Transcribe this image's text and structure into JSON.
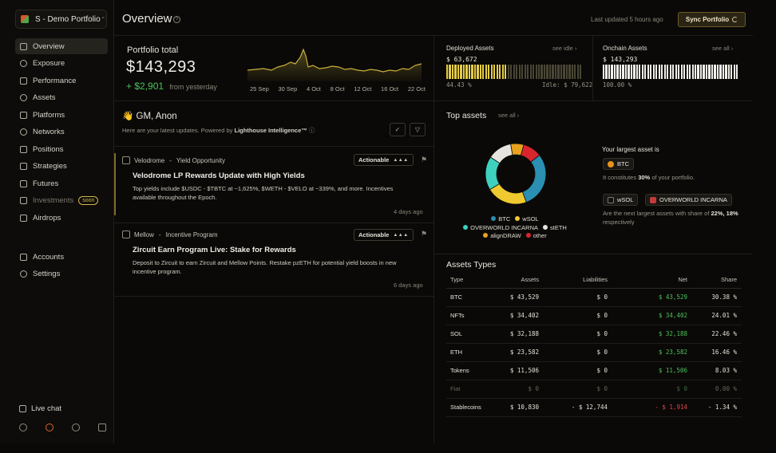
{
  "sidebar": {
    "portfolio_name": "S - Demo Portfolio",
    "items": [
      {
        "label": "Overview"
      },
      {
        "label": "Exposure"
      },
      {
        "label": "Performance"
      },
      {
        "label": "Assets"
      },
      {
        "label": "Platforms"
      },
      {
        "label": "Networks"
      },
      {
        "label": "Positions"
      },
      {
        "label": "Strategies"
      },
      {
        "label": "Futures"
      },
      {
        "label": "Investments",
        "badge": "soon"
      },
      {
        "label": "Airdrops"
      }
    ],
    "secondary": [
      {
        "label": "Accounts"
      },
      {
        "label": "Settings"
      }
    ],
    "live_chat": "Live chat"
  },
  "header": {
    "title": "Overview",
    "last_updated": "Last updated 5 hours ago",
    "sync_label": "Sync Portfolio"
  },
  "portfolio": {
    "label": "Portfolio total",
    "value": "$143,293",
    "change_sign": "+",
    "change_value": "$2,901",
    "change_suffix": "from yesterday",
    "dates": [
      "25 Sep",
      "30 Sep",
      "4 Oct",
      "8 Oct",
      "12 Oct",
      "16 Oct",
      "22 Oct"
    ]
  },
  "deployed": {
    "label": "Deployed Assets",
    "link": "see idle",
    "value": "$ 63,672",
    "percent": "44.43 %",
    "idle": "Idle: $ 79,622",
    "fill_fraction": 0.4443
  },
  "onchain": {
    "label": "Onchain Assets",
    "link": "see all",
    "value": "$ 143,293",
    "percent": "100.00 %",
    "fill_fraction": 1.0
  },
  "feed": {
    "title": "👋 GM, Anon",
    "subtitle_prefix": "Here are your latest updates. Powered by",
    "subtitle_brand": "Lighthouse Intelligence™",
    "cards": [
      {
        "source": "Velodrome",
        "category": "Yield Opportunity",
        "status": "Actionable",
        "title": "Velodrome LP Rewards Update with High Yields",
        "body": "Top yields include $USDC - $TBTC at ~1,625%, $WETH - $VELO at ~339%, and more. Incentives available throughout the Epoch.",
        "time": "4 days ago"
      },
      {
        "source": "Mellow",
        "category": "Incentive Program",
        "status": "Actionable",
        "title": "Zircuit Earn Program Live: Stake for Rewards",
        "body": "Deposit to Zircuit to earn Zircuit and Mellow Points. Restake pzETH for potential yield boosts in new incentive program.",
        "time": "6 days ago"
      }
    ]
  },
  "top_assets": {
    "title": "Top assets",
    "link": "see all",
    "largest_title": "Your largest asset is",
    "largest_asset": "BTC",
    "constitutes_prefix": "It constitutes",
    "constitutes_value": "30%",
    "constitutes_suffix": "of your portfolio.",
    "next_assets": [
      "wSOL",
      "OVERWORLD INCARNA"
    ],
    "next_note_prefix": "Are the next largest assets with share of",
    "next_note_values": "22%, 18%",
    "next_note_suffix": "respectively",
    "legend": [
      {
        "name": "BTC",
        "color": "#2a8fb0"
      },
      {
        "name": "wSOL",
        "color": "#f0c930"
      },
      {
        "name": "OVERWORLD INCARNA",
        "color": "#3ed1c0"
      },
      {
        "name": "stETH",
        "color": "#e6e4de"
      },
      {
        "name": "alignDRAW",
        "color": "#e8a21c"
      },
      {
        "name": "other",
        "color": "#d9262e"
      }
    ]
  },
  "chart_data": {
    "type": "pie",
    "categories": [
      "BTC",
      "wSOL",
      "OVERWORLD INCARNA",
      "stETH",
      "alignDRAW",
      "other"
    ],
    "values": [
      30,
      22,
      18,
      13,
      7,
      10
    ]
  },
  "asset_types": {
    "title": "Assets Types",
    "headers": [
      "Type",
      "Assets",
      "Liabilities",
      "Net",
      "Share"
    ],
    "rows": [
      {
        "type": "BTC",
        "assets": "$ 43,529",
        "liabilities": "$ 0",
        "net": "$ 43,529",
        "share": "30.38 %",
        "net_class": "pos"
      },
      {
        "type": "NFTs",
        "assets": "$ 34,402",
        "liabilities": "$ 0",
        "net": "$ 34,402",
        "share": "24.01 %",
        "net_class": "pos"
      },
      {
        "type": "SOL",
        "assets": "$ 32,188",
        "liabilities": "$ 0",
        "net": "$ 32,188",
        "share": "22.46 %",
        "net_class": "pos"
      },
      {
        "type": "ETH",
        "assets": "$ 23,582",
        "liabilities": "$ 0",
        "net": "$ 23,582",
        "share": "16.46 %",
        "net_class": "pos"
      },
      {
        "type": "Tokens",
        "assets": "$ 11,506",
        "liabilities": "$ 0",
        "net": "$ 11,506",
        "share": "8.03 %",
        "net_class": "pos"
      },
      {
        "type": "Fiat",
        "assets": "$ 0",
        "liabilities": "$ 0",
        "net": "$ 0",
        "share": "0.00 %",
        "net_class": "pos",
        "dim": true
      },
      {
        "type": "Stablecoins",
        "assets": "$ 10,830",
        "liabilities": "- $ 12,744",
        "net": "- $ 1,914",
        "share": "- 1.34 %",
        "net_class": "neg"
      }
    ]
  }
}
